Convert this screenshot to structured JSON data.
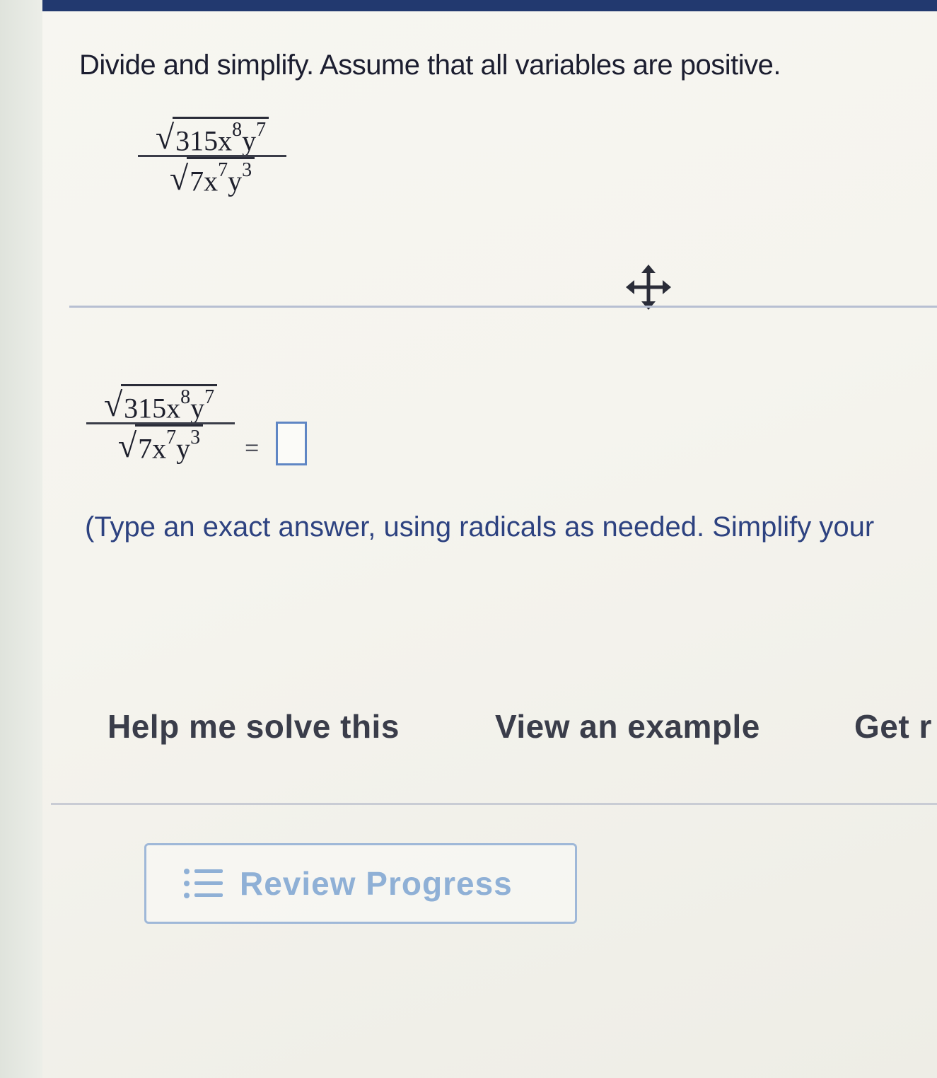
{
  "header": {
    "bar_color": "#22396f"
  },
  "problem": {
    "instruction": "Divide and simplify. Assume that all variables are positive.",
    "expression": {
      "numerator": {
        "coefficient": "315x",
        "x_exp": "8",
        "var2": "y",
        "y_exp": "7"
      },
      "denominator": {
        "coefficient": "7x",
        "x_exp": "7",
        "var2": "y",
        "y_exp": "3"
      }
    }
  },
  "toolbar": {
    "move_icon": "move-arrows-icon"
  },
  "answer": {
    "equals": "=",
    "value": "",
    "hint": "(Type an exact answer, using radicals as needed. Simplify your"
  },
  "help": {
    "solve_label": "Help me solve this",
    "example_label": "View an example",
    "more_label": "Get r"
  },
  "review": {
    "icon": "list-icon",
    "label": "Review Progress",
    "color": "#8fb0d6"
  }
}
